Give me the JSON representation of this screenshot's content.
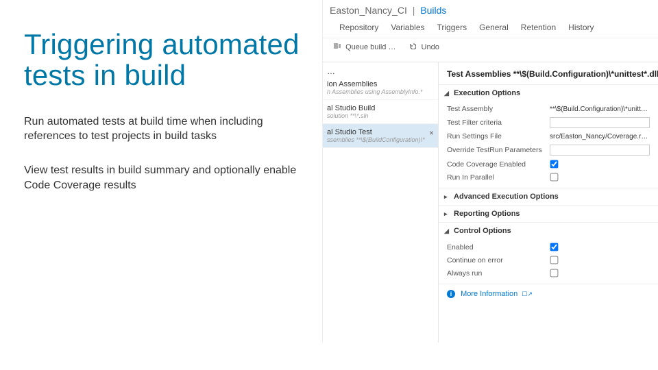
{
  "slide": {
    "title": "Triggering automated tests in build",
    "bullet1": "Run automated tests at build time when including references to test projects in build tasks",
    "bullet2": "View test results in build summary and optionally enable Code Coverage results"
  },
  "breadcrumb": {
    "project": "Easton_Nancy_CI",
    "section": "Builds"
  },
  "tabs": [
    "Repository",
    "Variables",
    "Triggers",
    "General",
    "Retention",
    "History"
  ],
  "toolbar": {
    "queue": "Queue build …",
    "undo": "Undo"
  },
  "tasks": {
    "head": "…",
    "row0": {
      "name": "ion Assemblies",
      "desc": "n Assemblies using AssemblyInfo.*"
    },
    "row1": {
      "name": "al Studio Build",
      "desc": "solution **\\*.sln"
    },
    "row2": {
      "name": "al Studio Test",
      "desc": "ssemblies **\\$(BuildConfiguration)\\*"
    }
  },
  "detail": {
    "title": "Test Assemblies **\\$(Build.Configuration)\\*unittest*.dll;-:**\\o",
    "sec_exec": "Execution Options",
    "sec_adv": "Advanced Execution Options",
    "sec_rep": "Reporting Options",
    "sec_ctrl": "Control Options",
    "f_assembly_label": "Test Assembly",
    "f_assembly_val": "**\\$(Build.Configuration)\\*unittest*.d",
    "f_filter_label": "Test Filter criteria",
    "f_filter_val": "",
    "f_runsettings_label": "Run Settings File",
    "f_runsettings_val": "src/Easton_Nancy/Coverage.runsetti",
    "f_override_label": "Override TestRun Parameters",
    "f_override_val": "",
    "f_cc_label": "Code Coverage Enabled",
    "f_parallel_label": "Run In Parallel",
    "c_enabled_label": "Enabled",
    "c_continue_label": "Continue on error",
    "c_always_label": "Always run",
    "more_info": "More Information"
  }
}
